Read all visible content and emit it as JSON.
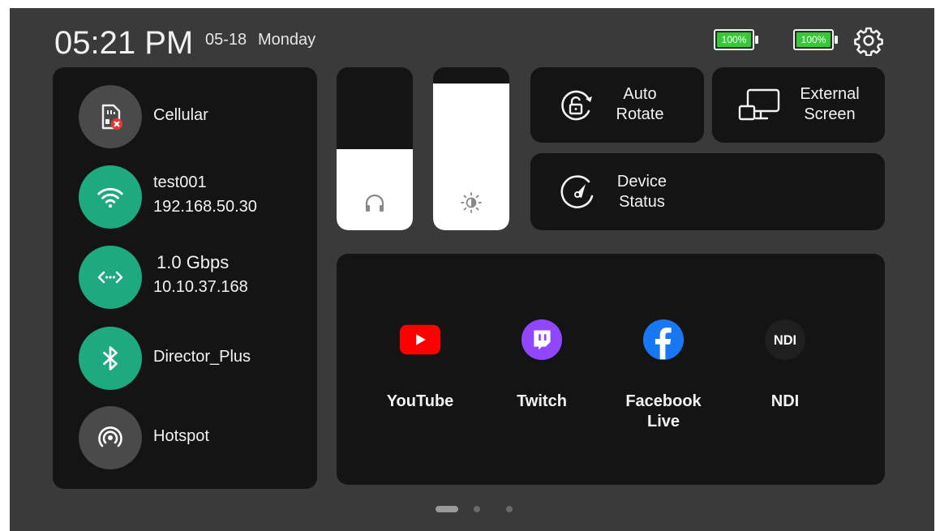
{
  "status_bar": {
    "time": "05:21 PM",
    "date": "05-18",
    "day": "Monday",
    "batteries": [
      {
        "label": "100%",
        "level": 1.0,
        "color": "#36c836"
      },
      {
        "label": "100%",
        "level": 1.0,
        "color": "#36c836"
      }
    ],
    "settings_icon": "gear-icon"
  },
  "network": {
    "cellular": {
      "label": "Cellular",
      "icon": "sim-card-error-icon",
      "status": "disconnected"
    },
    "wifi": {
      "ssid": "test001",
      "ip": "192.168.50.30",
      "icon": "wifi-icon"
    },
    "ethernet": {
      "speed": "1.0 Gbps",
      "ip": "10.10.37.168",
      "icon": "ethernet-icon"
    },
    "bluetooth": {
      "device": "Director_Plus",
      "icon": "bluetooth-icon"
    },
    "hotspot": {
      "label": "Hotspot",
      "icon": "hotspot-icon"
    }
  },
  "sliders": {
    "volume": {
      "icon": "headphones-icon",
      "level": 0.5
    },
    "brightness": {
      "icon": "brightness-icon",
      "level": 0.9
    }
  },
  "quick_tiles": {
    "auto_rotate": {
      "line1": "Auto",
      "line2": "Rotate",
      "icon": "rotate-lock-icon"
    },
    "external_screen": {
      "line1": "External",
      "line2": "Screen",
      "icon": "external-screen-icon"
    },
    "device_status": {
      "line1": "Device",
      "line2": "Status",
      "icon": "gauge-icon"
    }
  },
  "apps": [
    {
      "label": "YouTube",
      "icon": "youtube-icon",
      "color": "#ff0000"
    },
    {
      "label": "Twitch",
      "icon": "twitch-icon",
      "color": "#9146ff"
    },
    {
      "label": "Facebook",
      "label2": "Live",
      "icon": "facebook-icon",
      "color": "#1877f2"
    },
    {
      "label": "NDI",
      "icon": "ndi-icon",
      "color": "#1f1f1f"
    }
  ],
  "pager": {
    "pages": 3,
    "current": 1
  },
  "colors": {
    "accent_green": "#1fa97f",
    "background": "#3a3a3a",
    "panel": "#141414"
  }
}
